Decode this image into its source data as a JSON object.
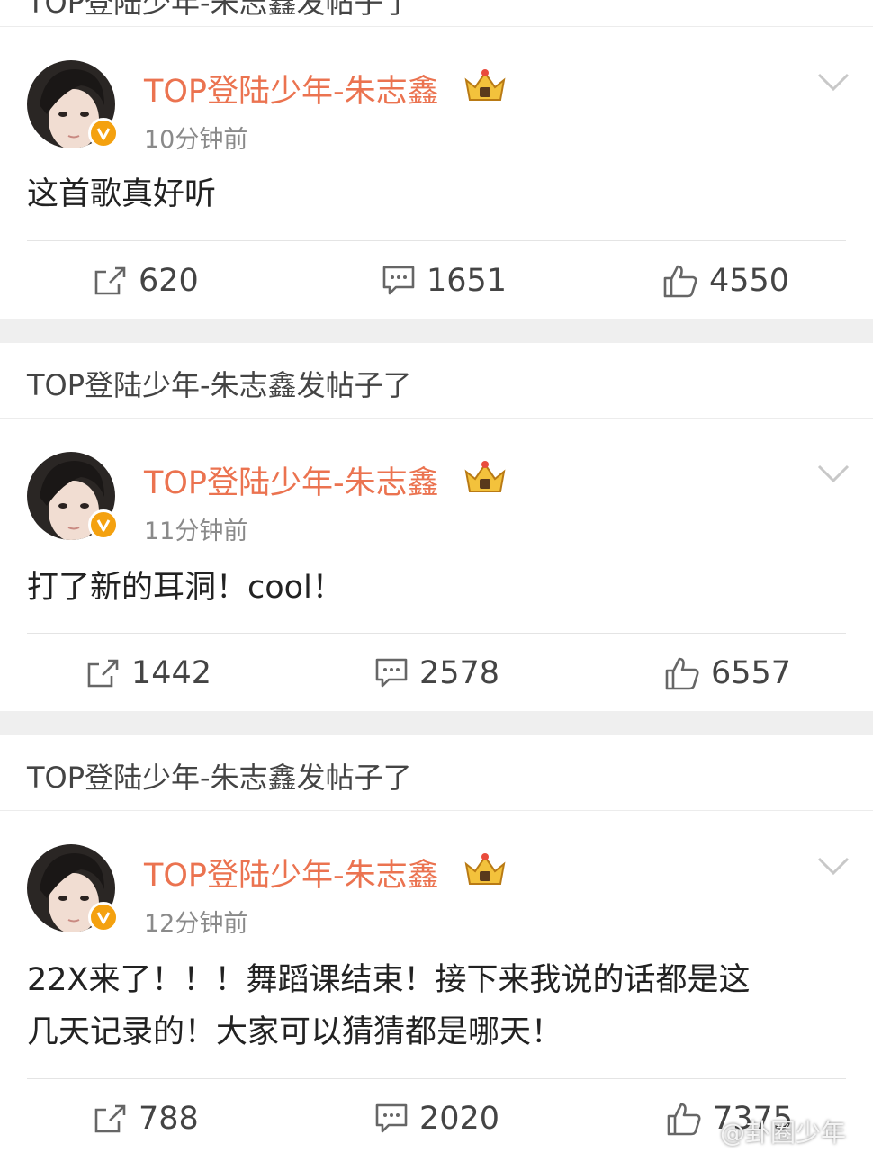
{
  "top_strip": {
    "text": "TOP登陆少年-朱志鑫发帖子了"
  },
  "posts": [
    {
      "header": "",
      "author": {
        "name": "TOP登陆少年-朱志鑫",
        "verified": true,
        "crown": "crown-icon"
      },
      "time": "10分钟前",
      "content": "这首歌真好听",
      "actions": {
        "repost": "620",
        "comment": "1651",
        "like": "4550"
      }
    },
    {
      "header": "TOP登陆少年-朱志鑫发帖子了",
      "author": {
        "name": "TOP登陆少年-朱志鑫",
        "verified": true,
        "crown": "crown-icon"
      },
      "time": "11分钟前",
      "content": "打了新的耳洞！cool！",
      "actions": {
        "repost": "1442",
        "comment": "2578",
        "like": "6557"
      }
    },
    {
      "header": "TOP登陆少年-朱志鑫发帖子了",
      "author": {
        "name": "TOP登陆少年-朱志鑫",
        "verified": true,
        "crown": "crown-icon"
      },
      "time": "12分钟前",
      "content_lines": [
        "22X来了！！！舞蹈课结束！接下来我说的话都是这",
        "几天记录的！大家可以猜猜都是哪天！"
      ],
      "actions": {
        "repost": "788",
        "comment": "2020",
        "like": "7375"
      }
    }
  ],
  "watermark": "@卦圈少年",
  "colors": {
    "username": "#eb7350",
    "verified_badge": "#f4a10f",
    "separator": "#efefef"
  }
}
